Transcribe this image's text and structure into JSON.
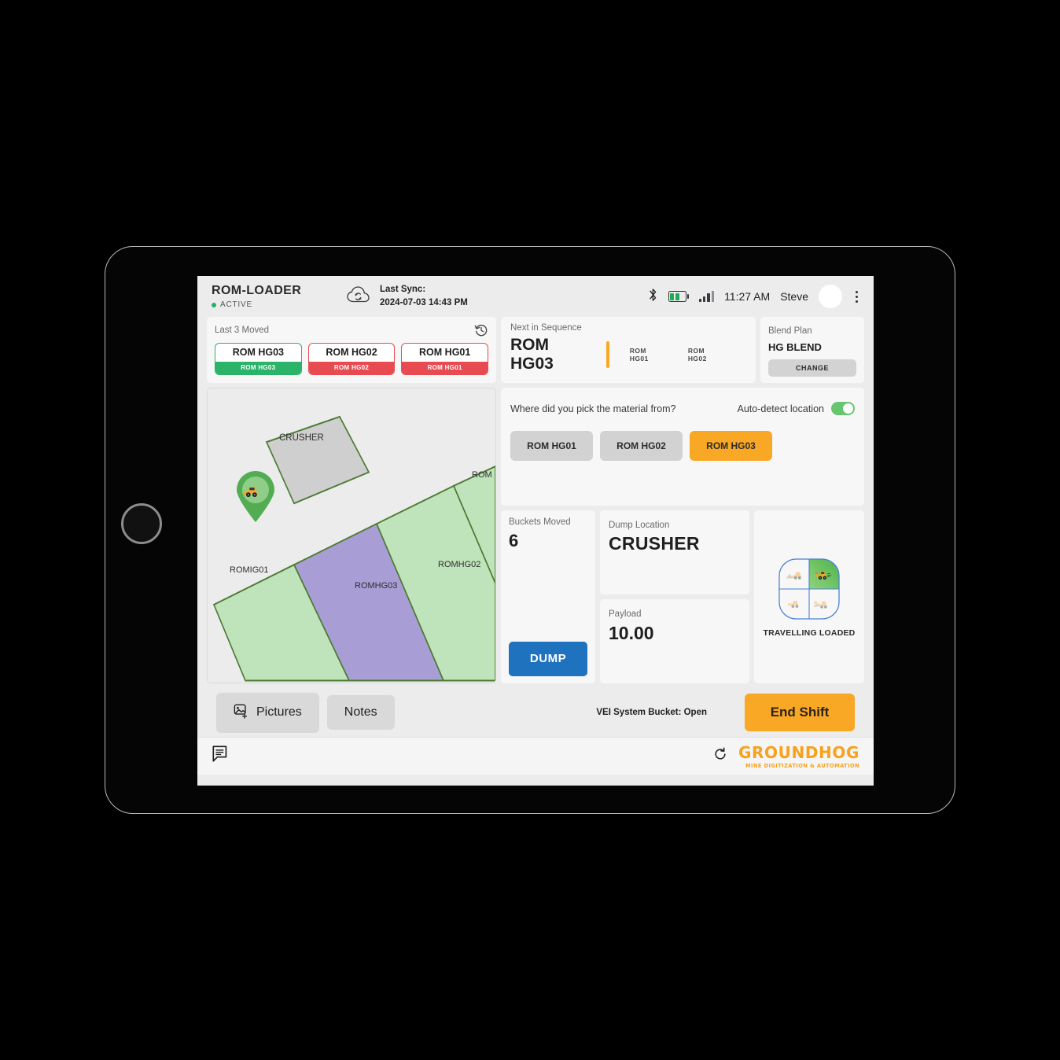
{
  "header": {
    "brand_title": "ROM-LOADER",
    "status": "ACTIVE",
    "sync_icon": "cloud-sync-icon",
    "sync_label": "Last Sync:",
    "sync_time": "2024-07-03 14:43 PM",
    "bluetooth_icon": "bluetooth-icon",
    "battery_icon": "battery-icon",
    "signal_icon": "signal-bars-icon",
    "clock": "11:27 AM",
    "user_name": "Steve",
    "avatar": "user-avatar",
    "menu_icon": "kebab-menu-icon"
  },
  "last_moved": {
    "label": "Last 3 Moved",
    "history_icon": "history-icon",
    "items": [
      {
        "title": "ROM HG03",
        "sub": "ROM HG03",
        "color": "green"
      },
      {
        "title": "ROM HG02",
        "sub": "ROM HG02",
        "color": "red"
      },
      {
        "title": "ROM HG01",
        "sub": "ROM HG01",
        "color": "red"
      }
    ]
  },
  "next_sequence": {
    "label": "Next in Sequence",
    "current": "ROM HG03",
    "queue": [
      "ROM HG01",
      "ROM HG02"
    ]
  },
  "blend_plan": {
    "label": "Blend Plan",
    "value": "HG BLEND",
    "change_label": "CHANGE"
  },
  "map": {
    "crusher_label": "CRUSHER",
    "zones": [
      {
        "name": "ROMIG01"
      },
      {
        "name": "ROMHG03"
      },
      {
        "name": "ROMHG02"
      },
      {
        "name": "ROM"
      }
    ],
    "vehicle_pin": "loader-location-pin"
  },
  "pick_location": {
    "question": "Where did you pick the material from?",
    "auto_detect_label": "Auto-detect location",
    "auto_detect_on": true,
    "options": [
      {
        "label": "ROM HG01",
        "selected": false
      },
      {
        "label": "ROM HG02",
        "selected": false
      },
      {
        "label": "ROM HG03",
        "selected": true
      }
    ]
  },
  "buckets": {
    "label": "Buckets Moved",
    "value": "6",
    "dump_label": "DUMP"
  },
  "dump_location": {
    "label": "Dump Location",
    "value": "CRUSHER"
  },
  "payload": {
    "label": "Payload",
    "value": "10.00"
  },
  "machine_state": {
    "label": "TRAVELLING LOADED",
    "icon": "loader-state-quadrant-icon",
    "active_quadrant": "top-right"
  },
  "footer": {
    "pictures_label": "Pictures",
    "pictures_icon": "add-picture-icon",
    "notes_label": "Notes",
    "vei_status": "VEI System Bucket: Open",
    "end_shift_label": "End Shift"
  },
  "bottom_bar": {
    "chat_icon": "message-icon",
    "refresh_icon": "refresh-icon",
    "logo_main": "GROUNDHOG",
    "logo_sub": "MINE DIGITIZATION & AUTOMATION"
  },
  "colors": {
    "accent_orange": "#f9a825",
    "brand_orange": "#f9a11b",
    "blue": "#1f72bd",
    "green": "#2cb36a",
    "red": "#e84a52"
  }
}
